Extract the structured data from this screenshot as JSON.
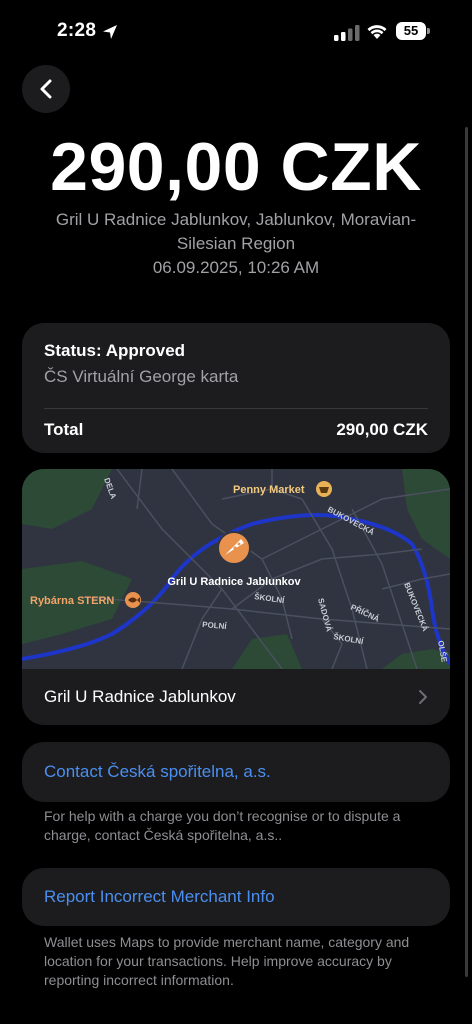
{
  "status_bar": {
    "time": "2:28",
    "battery": "55"
  },
  "transaction": {
    "amount": "290,00 CZK",
    "merchant_address": "Gril U Radnice Jablunkov, Jablunkov, Moravian-Silesian Region",
    "datetime": "06.09.2025, 10:26 AM"
  },
  "status_card": {
    "status": "Status: Approved",
    "card_name": "ČS Virtuální George karta",
    "total_label": "Total",
    "total_value": "290,00 CZK"
  },
  "map": {
    "merchant_pin_label": "Gril U Radnice Jablunkov",
    "poi_penny": "Penny Market",
    "poi_rybarna": "Rybárna STERN",
    "streets": [
      "BUKOVECKÁ",
      "ŠKOLNÍ",
      "POLNÍ",
      "SADOVÁ",
      "PŘÍČNÁ",
      "BUKOVECKÁ",
      "ŠKOLNÍ",
      "OLŠE",
      "DELA"
    ],
    "colors": {
      "background": "#2f3440",
      "green": "#2c4a35",
      "river": "#1d35c9",
      "pin": "#e8924e"
    }
  },
  "merchant_row": {
    "label": "Gril U Radnice Jablunkov"
  },
  "contact": {
    "link": "Contact Česká spořitelna, a.s.",
    "help": "For help with a charge you don’t recognise or to dispute a charge, contact Česká spořitelna, a.s.."
  },
  "report": {
    "link": "Report Incorrect Merchant Info",
    "wallet_note": "Wallet uses Maps to provide merchant name, category and location for your transactions. Help improve accuracy by reporting incorrect information."
  },
  "icons": {
    "back": "chevron-left-icon",
    "merchant": "chevron-right-icon",
    "location": "location-arrow-icon",
    "signal": "cellular-signal-icon",
    "wifi": "wifi-icon",
    "pin": "pizza-icon",
    "shop": "shopping-basket-icon",
    "fish": "fish-icon"
  }
}
